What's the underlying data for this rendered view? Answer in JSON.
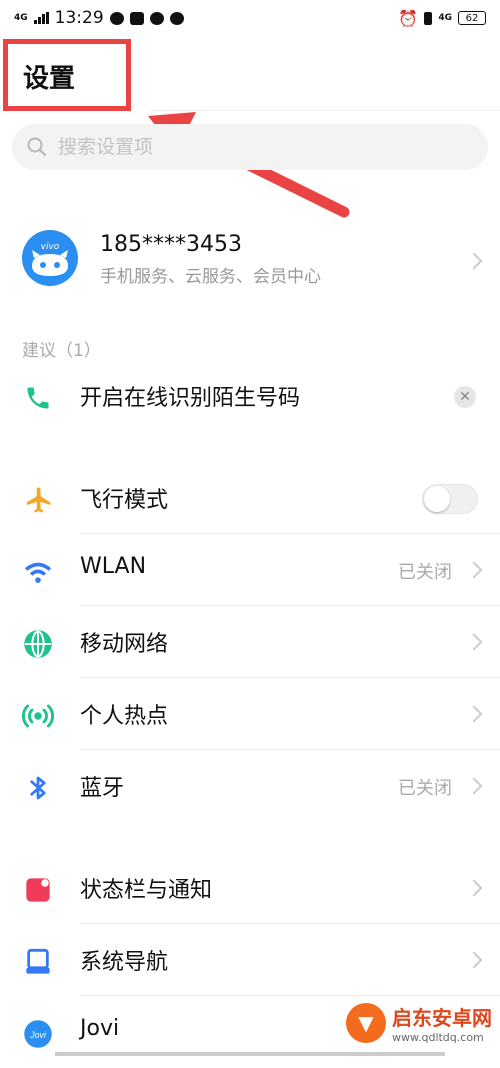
{
  "status_bar": {
    "network_label": "4G",
    "time": "13:29",
    "right_network": "4G",
    "battery": "62"
  },
  "header": {
    "title": "设置"
  },
  "search": {
    "placeholder": "搜索设置项"
  },
  "account": {
    "name": "185****3453",
    "subtitle": "手机服务、云服务、会员中心",
    "brand": "vivo"
  },
  "suggestions": {
    "label": "建议（1）",
    "items": [
      {
        "label": "开启在线识别陌生号码",
        "icon": "phone-icon",
        "color": "#1ec28b"
      }
    ]
  },
  "network_settings": [
    {
      "label": "飞行模式",
      "icon": "airplane-icon",
      "color": "#f5a623",
      "control": "toggle",
      "toggle_on": false
    },
    {
      "label": "WLAN",
      "icon": "wifi-icon",
      "color": "#3478f6",
      "value": "已关闭"
    },
    {
      "label": "移动网络",
      "icon": "globe-icon",
      "color": "#1ec28b",
      "value": ""
    },
    {
      "label": "个人热点",
      "icon": "hotspot-icon",
      "color": "#1ec28b",
      "value": ""
    },
    {
      "label": "蓝牙",
      "icon": "bluetooth-icon",
      "color": "#3478f6",
      "value": "已关闭"
    }
  ],
  "system_settings": [
    {
      "label": "状态栏与通知",
      "icon": "notification-icon",
      "color": "#f03c5a"
    },
    {
      "label": "系统导航",
      "icon": "navigation-icon",
      "color": "#3478f6"
    },
    {
      "label": "Jovi",
      "icon": "jovi-icon",
      "color": "#2a8ff0"
    }
  ],
  "watermark": {
    "title": "启东安卓网",
    "url": "www.qdltdq.com"
  },
  "annotation_color": "#e94343"
}
